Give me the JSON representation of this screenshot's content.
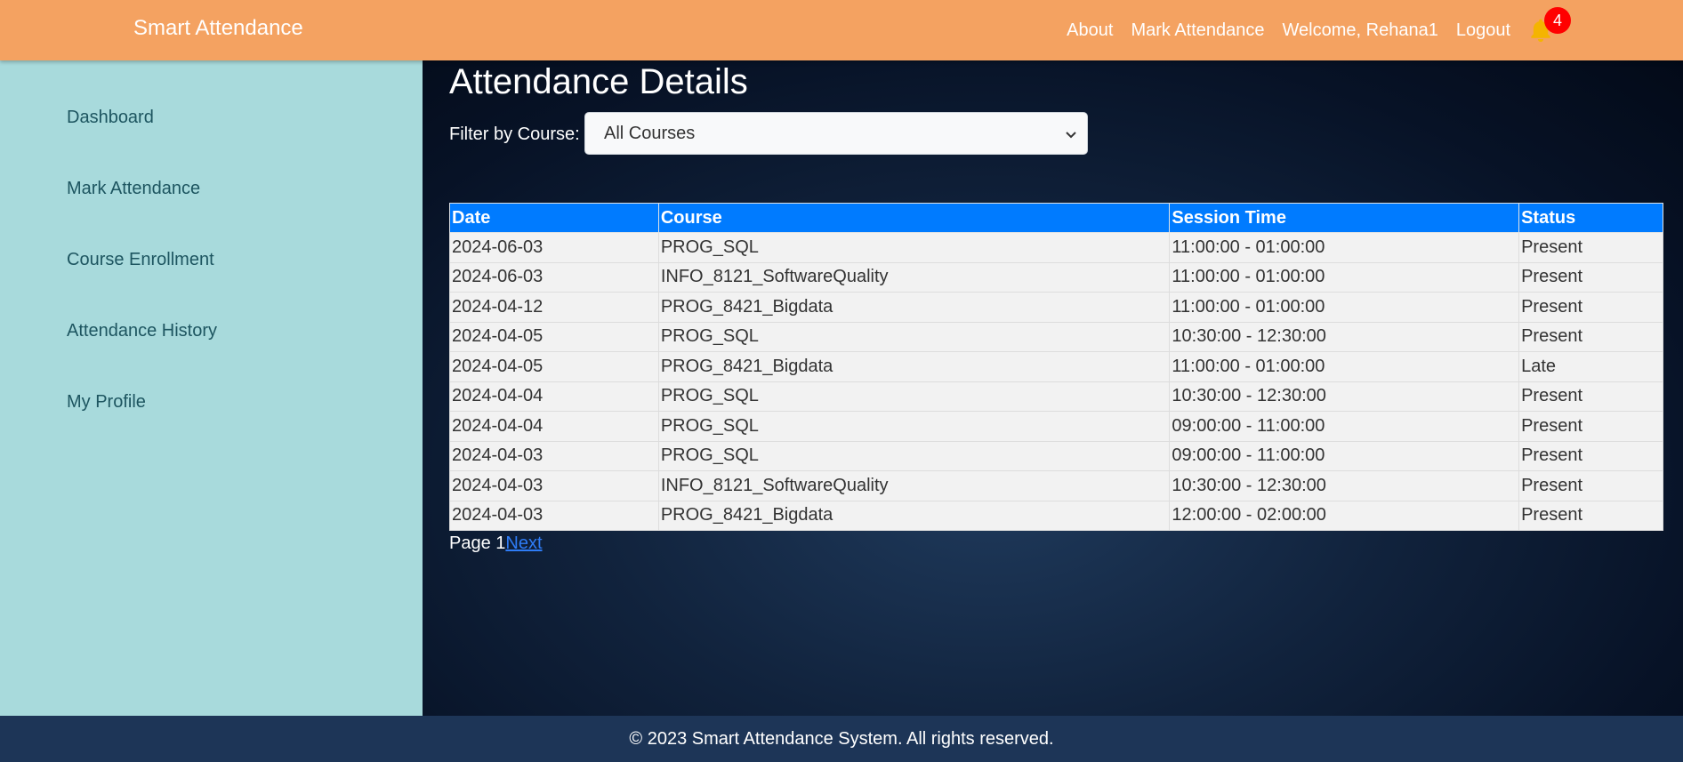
{
  "navbar": {
    "brand": "Smart Attendance",
    "links": {
      "about": "About",
      "mark_attendance": "Mark Attendance",
      "welcome": "Welcome, Rehana1",
      "logout": "Logout"
    },
    "notification_icon": "bell-icon",
    "notification_count": "4",
    "background_color": "#f4a261",
    "badge_color": "#ff0000"
  },
  "sidebar": {
    "background_color": "#a8dadc",
    "items": [
      {
        "label": "Dashboard"
      },
      {
        "label": "Mark Attendance"
      },
      {
        "label": "Course Enrollment"
      },
      {
        "label": "Attendance History"
      },
      {
        "label": "My Profile"
      }
    ]
  },
  "main": {
    "title": "Attendance Details",
    "filter": {
      "label": "Filter by Course:",
      "selected": "All Courses"
    },
    "table": {
      "header_color": "#007bff",
      "headers": [
        "Date",
        "Course",
        "Session Time",
        "Status"
      ],
      "rows": [
        [
          "2024-06-03",
          "PROG_SQL",
          "11:00:00 - 01:00:00",
          "Present"
        ],
        [
          "2024-06-03",
          "INFO_8121_SoftwareQuality",
          "11:00:00 - 01:00:00",
          "Present"
        ],
        [
          "2024-04-12",
          "PROG_8421_Bigdata",
          "11:00:00 - 01:00:00",
          "Present"
        ],
        [
          "2024-04-05",
          "PROG_SQL",
          "10:30:00 - 12:30:00",
          "Present"
        ],
        [
          "2024-04-05",
          "PROG_8421_Bigdata",
          "11:00:00 - 01:00:00",
          "Late"
        ],
        [
          "2024-04-04",
          "PROG_SQL",
          "10:30:00 - 12:30:00",
          "Present"
        ],
        [
          "2024-04-04",
          "PROG_SQL",
          "09:00:00 - 11:00:00",
          "Present"
        ],
        [
          "2024-04-03",
          "PROG_SQL",
          "09:00:00 - 11:00:00",
          "Present"
        ],
        [
          "2024-04-03",
          "INFO_8121_SoftwareQuality",
          "10:30:00 - 12:30:00",
          "Present"
        ],
        [
          "2024-04-03",
          "PROG_8421_Bigdata",
          "12:00:00 - 02:00:00",
          "Present"
        ]
      ]
    },
    "pagination": {
      "page_text": "Page 1",
      "next_label": "Next"
    }
  },
  "footer": {
    "text": "© 2023 Smart Attendance System. All rights reserved.",
    "background_color": "#1d3557"
  }
}
